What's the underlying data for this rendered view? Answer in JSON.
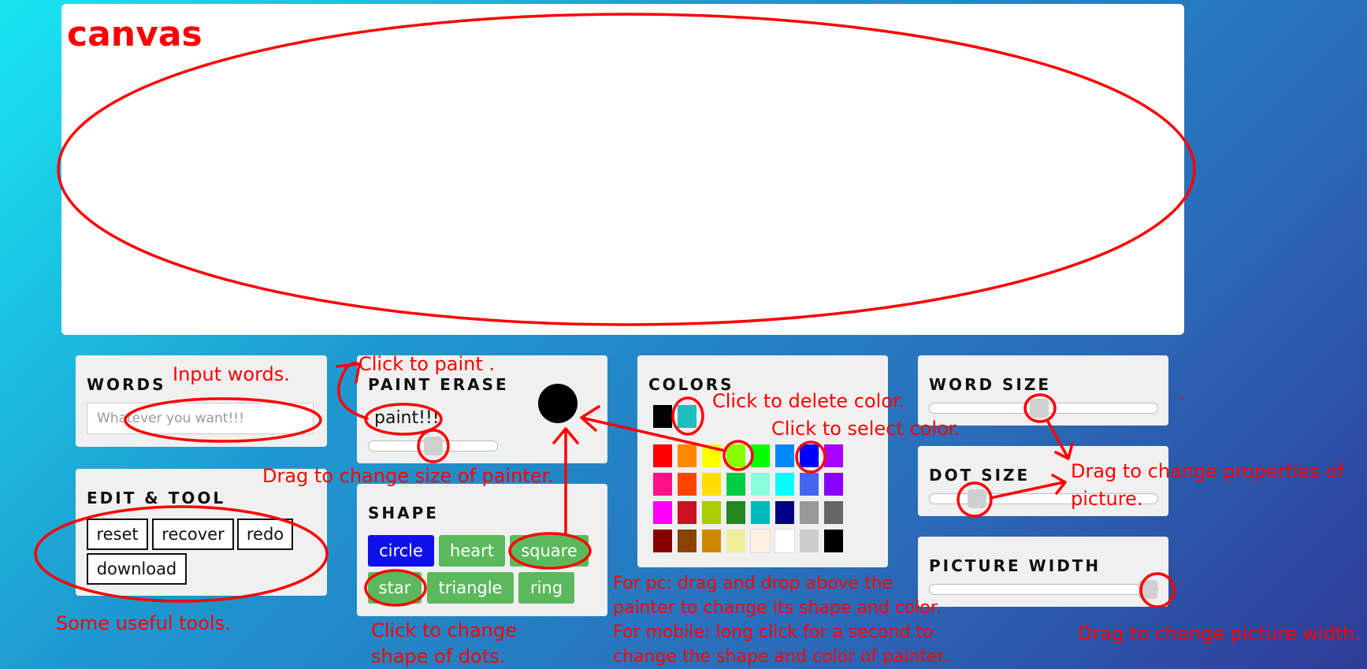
{
  "canvas": {
    "label": "canvas"
  },
  "words": {
    "title": "WORDS",
    "placeholder": "Whatever you want!!!"
  },
  "edit_tool": {
    "title": "EDIT & TOOL",
    "buttons": [
      "reset",
      "recover",
      "redo",
      "download"
    ]
  },
  "paint_erase": {
    "title": "PAINT ERASE",
    "mode": "paint!!!",
    "painter_size_fraction": 0.5
  },
  "shape": {
    "title": "SHAPE",
    "options": [
      "circle",
      "heart",
      "square",
      "star",
      "triangle",
      "ring"
    ],
    "selected": "circle"
  },
  "colors": {
    "title": "COLORS",
    "selected": [
      "#000000",
      "#1fbfbf"
    ],
    "palette": [
      [
        "#ff0000",
        "#ff8800",
        "#ffff00",
        "#88ff00",
        "#00ff00",
        "#0088ff",
        "#0000ff",
        "#aa00ff"
      ],
      [
        "#ff1188",
        "#ff4400",
        "#ffdd00",
        "#00cc44",
        "#88ffdd",
        "#00ffff",
        "#4466ee",
        "#8800ff"
      ],
      [
        "#ff00ff",
        "#cc1122",
        "#aacc00",
        "#228822",
        "#00bbbb",
        "#000088",
        "#999999",
        "#666666"
      ],
      [
        "#880000",
        "#884400",
        "#cc8800",
        "#eeee99",
        "#fff0e0",
        "#ffffff",
        "#cccccc",
        "#000000"
      ]
    ]
  },
  "word_size": {
    "title": "WORD SIZE",
    "value_fraction": 0.48
  },
  "dot_size": {
    "title": "DOT SIZE",
    "value_fraction": 0.18
  },
  "picture_width": {
    "title": "PICTURE WIDTH",
    "value_fraction": 1.0
  },
  "annotations": {
    "input_words": "Input words.",
    "click_to_paint": "Click to paint .",
    "drag_painter_size": "Drag to change size of painter.",
    "useful_tools": "Some useful tools.",
    "change_shape_1": "Click to change",
    "change_shape_2": "shape of dots.",
    "delete_color": "Click to delete color.",
    "select_color": "Click to select color.",
    "pc_1": "For pc: drag and drop above the",
    "pc_2": "painter to change its shape and color.",
    "mobile_1": "For mobile: long click for a second to",
    "mobile_2": "change the shape and color of painter.",
    "properties_1": "Drag to change properties of",
    "properties_2": "picture.",
    "picture_width": "Drag to change picture width.",
    "dot": "."
  }
}
